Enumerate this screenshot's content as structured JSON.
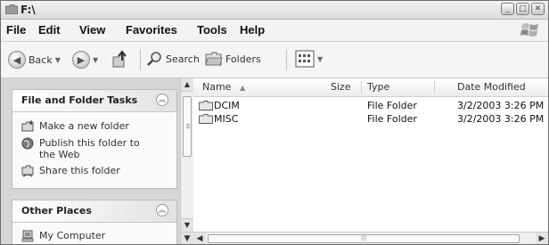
{
  "window": {
    "title": "F:\\"
  },
  "menubar": {
    "items": [
      "File",
      "Edit",
      "View",
      "Favorites",
      "Tools",
      "Help"
    ]
  },
  "toolbar": {
    "back_label": "Back",
    "search_label": "Search",
    "folders_label": "Folders"
  },
  "tasks": {
    "title": "File and Folder Tasks",
    "items": [
      {
        "label": "Make a new folder",
        "icon": "new-folder-icon"
      },
      {
        "label": "Publish this folder to the Web",
        "icon": "globe-icon"
      },
      {
        "label": "Share this folder",
        "icon": "share-folder-icon"
      }
    ]
  },
  "other_places": {
    "title": "Other Places",
    "items": [
      {
        "label": "My Computer",
        "icon": "my-computer-icon"
      }
    ]
  },
  "filelist": {
    "columns": [
      "Name",
      "Size",
      "Type",
      "Date Modified"
    ],
    "sort_column": "Name",
    "rows": [
      {
        "name": "DCIM",
        "size": "",
        "type": "File Folder",
        "modified": "3/2/2003 3:26 PM"
      },
      {
        "name": "MISC",
        "size": "",
        "type": "File Folder",
        "modified": "3/2/2003 3:26 PM"
      }
    ]
  }
}
